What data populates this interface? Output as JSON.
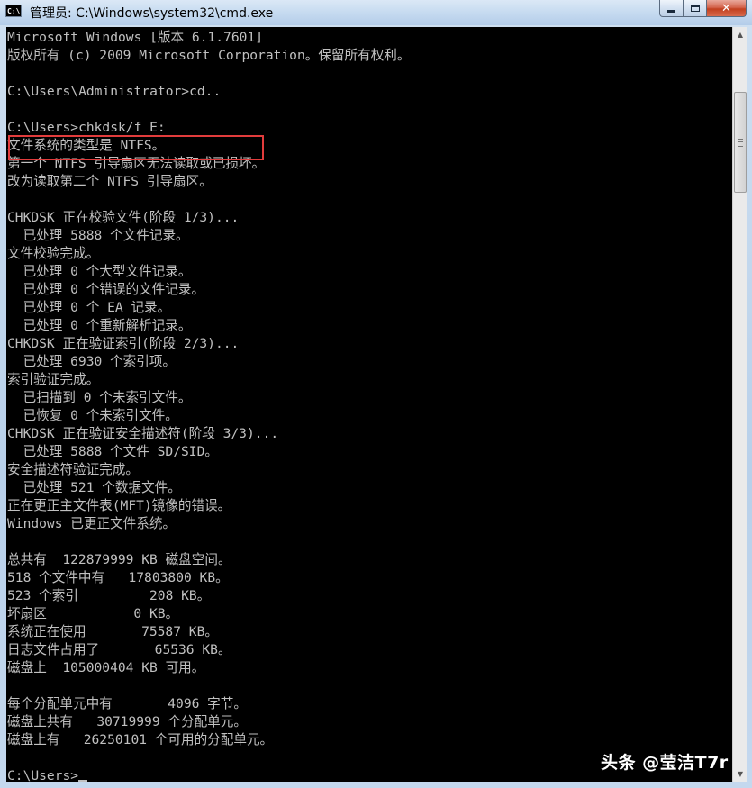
{
  "window": {
    "title": "管理员: C:\\Windows\\system32\\cmd.exe",
    "icon_text": "C:\\",
    "controls": {
      "minimize": "minimize-icon",
      "maximize": "maximize-icon",
      "close": "✕"
    }
  },
  "console": {
    "lines": [
      "Microsoft Windows [版本 6.1.7601]",
      "版权所有 (c) 2009 Microsoft Corporation。保留所有权利。",
      "",
      "C:\\Users\\Administrator>cd..",
      "",
      "C:\\Users>chkdsk/f E:",
      "文件系统的类型是 NTFS。",
      "第一个 NTFS 引导扇区无法读取或已损坏。",
      "改为读取第二个 NTFS 引导扇区。",
      "",
      "CHKDSK 正在校验文件(阶段 1/3)...",
      "  已处理 5888 个文件记录。",
      "文件校验完成。",
      "  已处理 0 个大型文件记录。",
      "  已处理 0 个错误的文件记录。",
      "  已处理 0 个 EA 记录。",
      "  已处理 0 个重新解析记录。",
      "CHKDSK 正在验证索引(阶段 2/3)...",
      "  已处理 6930 个索引项。",
      "索引验证完成。",
      "  已扫描到 0 个未索引文件。",
      "  已恢复 0 个未索引文件。",
      "CHKDSK 正在验证安全描述符(阶段 3/3)...",
      "  已处理 5888 个文件 SD/SID。",
      "安全描述符验证完成。",
      "  已处理 521 个数据文件。",
      "正在更正主文件表(MFT)镜像的错误。",
      "Windows 已更正文件系统。",
      "",
      "总共有  122879999 KB 磁盘空间。",
      "518 个文件中有   17803800 KB。",
      "523 个索引         208 KB。",
      "坏扇区           0 KB。",
      "系统正在使用       75587 KB。",
      "日志文件占用了       65536 KB。",
      "磁盘上  105000404 KB 可用。",
      "",
      "每个分配单元中有       4096 字节。",
      "磁盘上共有   30719999 个分配单元。",
      "磁盘上有   26250101 个可用的分配单元。",
      "",
      "C:\\Users>"
    ]
  },
  "scrollbar": {
    "up": "▲",
    "down": "▼"
  },
  "watermark": "头条 @莹洁T7r",
  "colors": {
    "console_bg": "#000000",
    "console_text": "#c0c0c0",
    "highlight_box": "#e23c3c",
    "close_button": "#c8452a"
  }
}
